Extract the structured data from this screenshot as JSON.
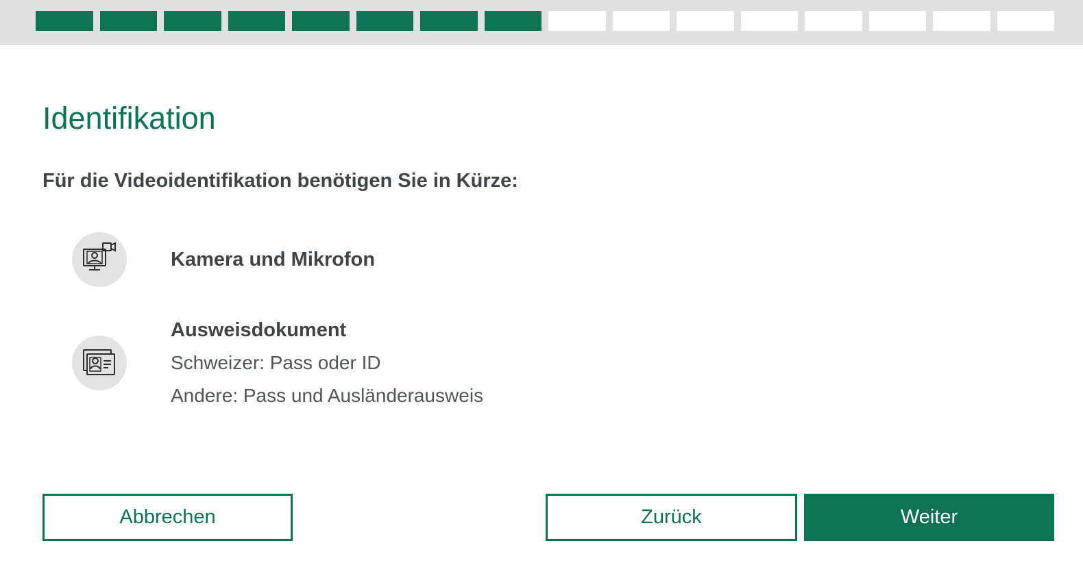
{
  "progress": {
    "total_steps": 16,
    "completed_steps": 8,
    "accent_color": "#0e7254",
    "inactive_color": "#ffffff"
  },
  "page": {
    "title": "Identifikation",
    "intro": "Für die Videoidentifikation benötigen Sie in Kürze:"
  },
  "requirements": [
    {
      "icon": "video-call-icon",
      "title": "Kamera und Mikrofon",
      "lines": []
    },
    {
      "icon": "id-document-icon",
      "title": "Ausweisdokument",
      "lines": [
        "Schweizer: Pass oder ID",
        "Andere: Pass und Ausländerausweis"
      ]
    }
  ],
  "buttons": {
    "cancel_label": "Abbrechen",
    "back_label": "Zurück",
    "next_label": "Weiter"
  },
  "colors": {
    "brand_green": "#0e7254",
    "text_dark": "#404447",
    "icon_bg": "#e3e3e3"
  }
}
